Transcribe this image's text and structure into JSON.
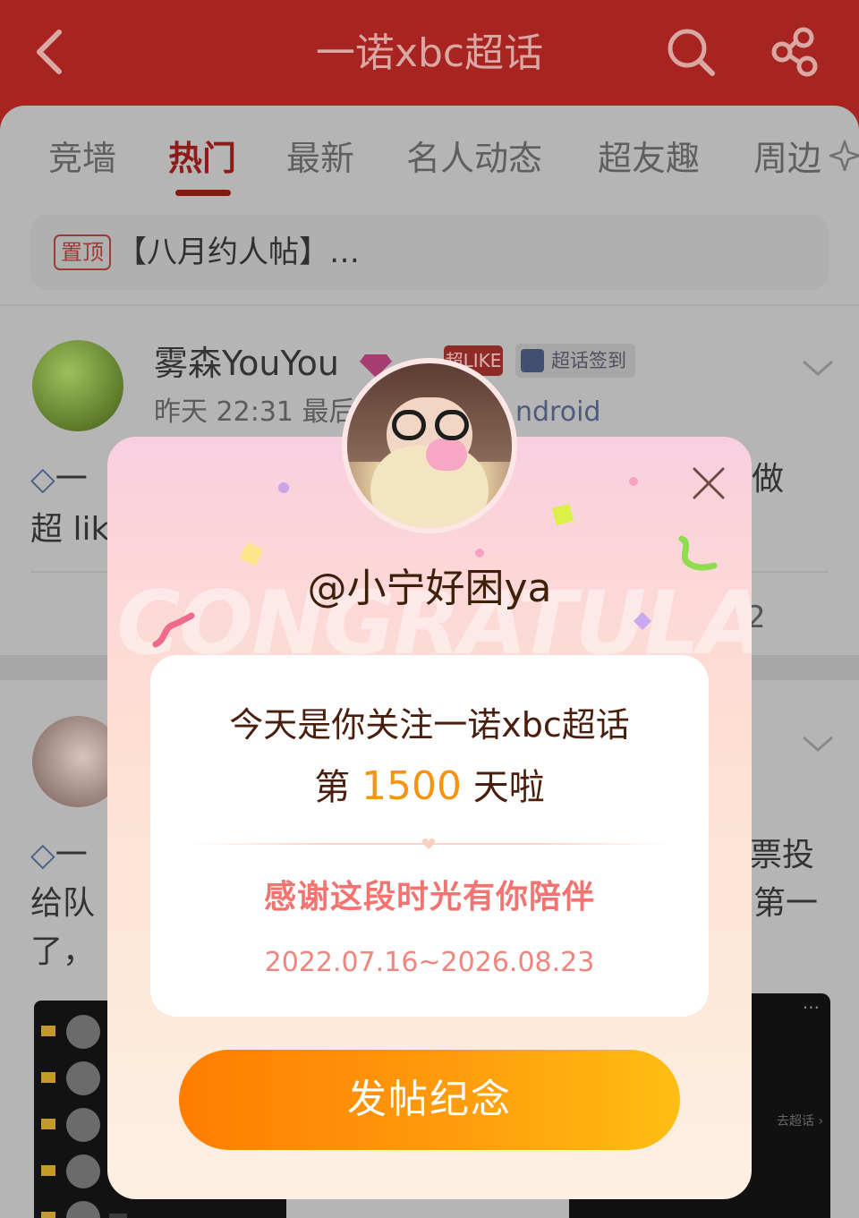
{
  "header": {
    "title": "一诺xbc超话",
    "back_icon": "chevron-left-icon",
    "search_icon": "search-icon",
    "share_icon": "share-icon"
  },
  "tabs": [
    {
      "label": "竞墙",
      "active": false
    },
    {
      "label": "热门",
      "active": true
    },
    {
      "label": "最新",
      "active": false
    },
    {
      "label": "名人动态",
      "active": false
    },
    {
      "label": "超友趣",
      "active": false
    },
    {
      "label": "周边",
      "active": false
    }
  ],
  "pinned": {
    "badge": "置顶",
    "text": "【八月约人帖】…"
  },
  "post1": {
    "username": "雾森YouYou",
    "like_badge": "超LIKE",
    "checkin_badge": "超话签到",
    "time": "昨天 22:31 最后",
    "device": "ndroid",
    "line1": "一",
    "line1_end": "做",
    "line2": "超 lik",
    "count": "2"
  },
  "post2": {
    "line1": "一",
    "line1_end": "票投",
    "line2": "给队",
    "line2_end": "第一",
    "line3": "了，",
    "img2_dots": "···",
    "img2_link": "去超话 ›"
  },
  "dialog": {
    "username": "@小宁好困ya",
    "watermark": "CONGRATULATE",
    "line1": "今天是你关注一诺xbc超话",
    "line2_prefix": "第 ",
    "days": "1500",
    "line2_suffix": " 天啦",
    "thanks": "感谢这段时光有你陪伴",
    "dates": "2022.07.16~2026.08.23",
    "button": "发帖纪念",
    "close_icon": "close-icon"
  },
  "colors": {
    "brand_red": "#a82420",
    "accent_orange": "#ff8a00",
    "thanks_pink": "#f27370",
    "days_orange": "#f49410"
  }
}
